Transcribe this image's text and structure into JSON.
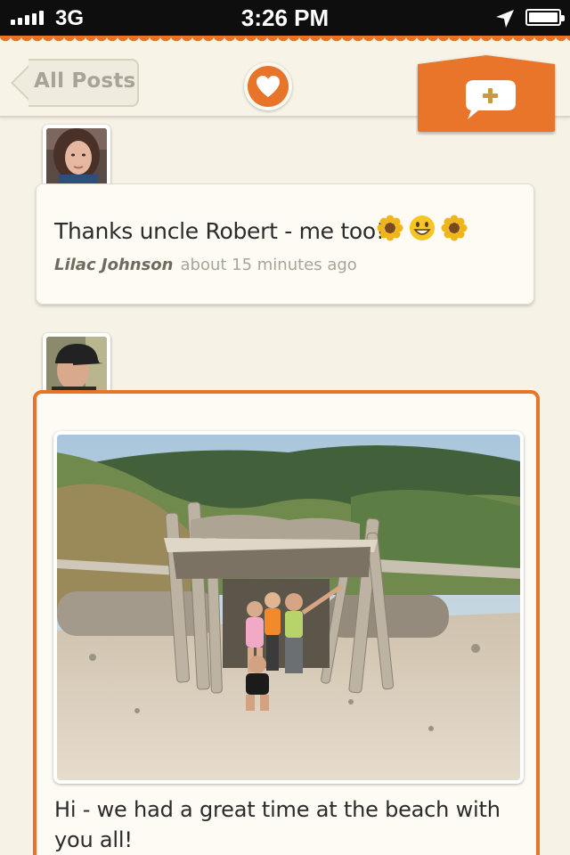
{
  "status_bar": {
    "carrier": "3G",
    "time": "3:26 PM"
  },
  "header": {
    "back_label": "All Posts"
  },
  "comment": {
    "text": "Thanks uncle Robert - me too!",
    "emojis": [
      "sunflower",
      "grinning-face",
      "sunflower"
    ],
    "author": "Lilac Johnson",
    "time": "about 15 minutes ago"
  },
  "post": {
    "text": "Hi - we had a great time at the beach with you all!"
  },
  "colors": {
    "accent": "#e8742a",
    "background": "#f6f2e6",
    "card": "#fdfbf4",
    "muted_text": "#a9a496"
  }
}
